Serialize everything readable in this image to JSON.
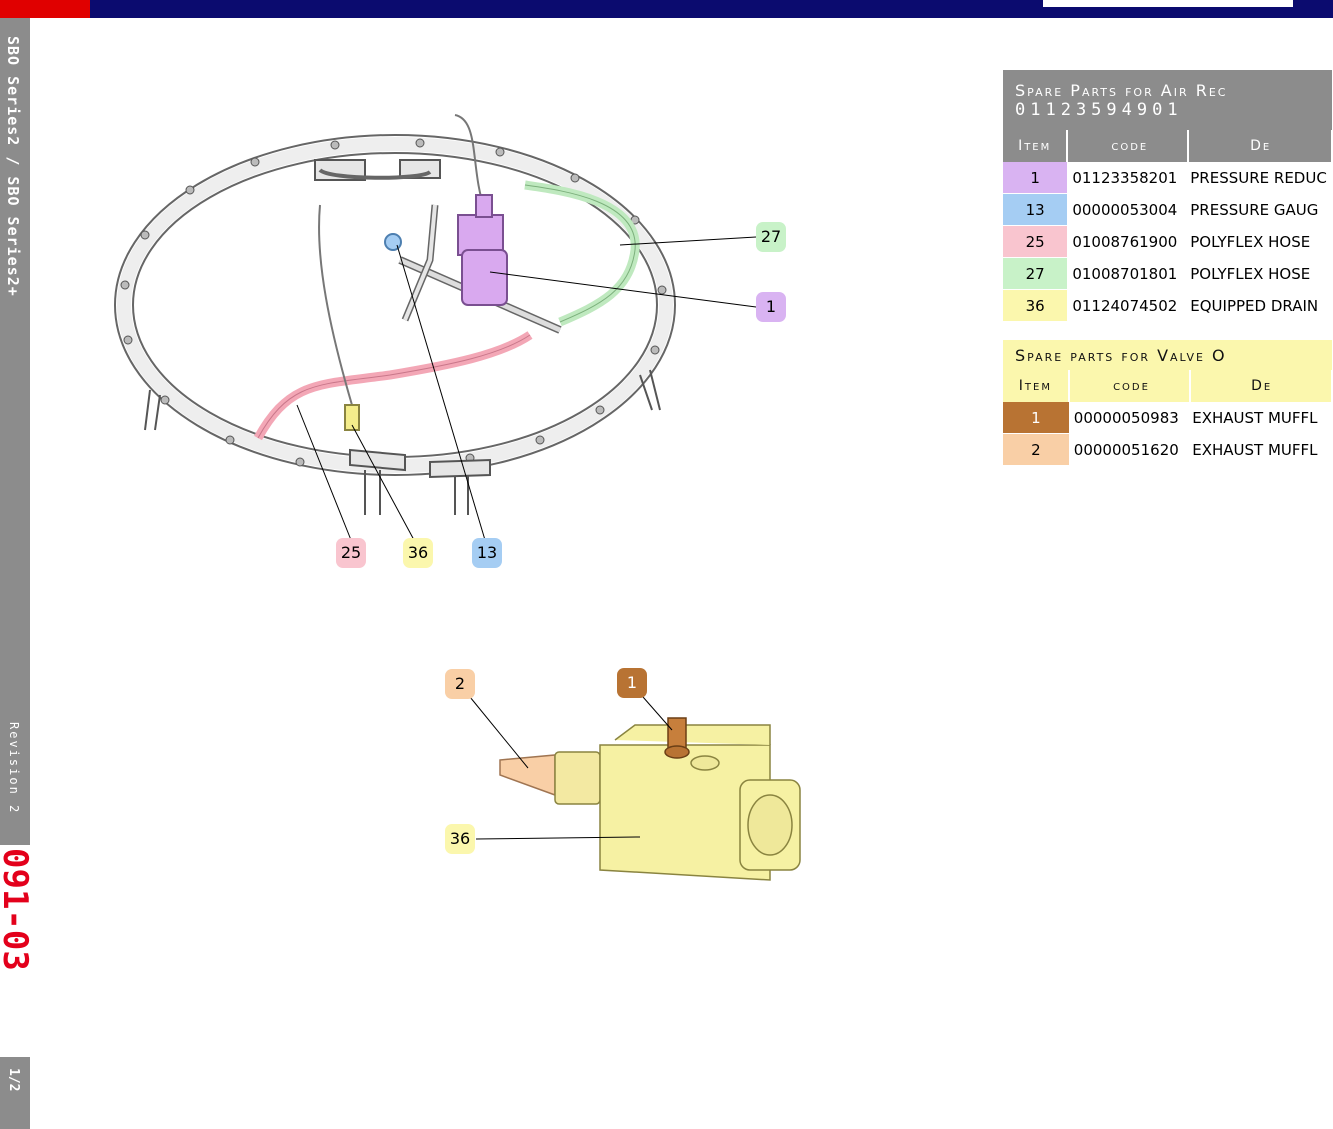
{
  "sidebar": {
    "series_text": "SBO Series2 / SBO Series2+",
    "revision": "Revision 2",
    "code": "091-03",
    "page": "1/2"
  },
  "table1": {
    "title_line1": "Spare Parts for Air Rec",
    "title_line2": "01123594901",
    "headers": [
      "Item",
      "code",
      "De"
    ],
    "rows": [
      {
        "item": "1",
        "code": "01123358201",
        "desc": "PRESSURE REDUC",
        "color": "#d9b3f2"
      },
      {
        "item": "13",
        "code": "00000053004",
        "desc": "PRESSURE GAUG",
        "color": "#a5cdf3"
      },
      {
        "item": "25",
        "code": "01008761900",
        "desc": "POLYFLEX HOSE",
        "color": "#f9c5cf"
      },
      {
        "item": "27",
        "code": "01008701801",
        "desc": "POLYFLEX HOSE",
        "color": "#c8f2c8"
      },
      {
        "item": "36",
        "code": "01124074502",
        "desc": "EQUIPPED DRAIN",
        "color": "#fbf7ad"
      }
    ]
  },
  "table2": {
    "title": "Spare parts for Valve O",
    "headers": [
      "Item",
      "code",
      "De"
    ],
    "rows": [
      {
        "item": "1",
        "code": "00000050983",
        "desc": "EXHAUST MUFFL",
        "color": "#b87333",
        "text_color": "#ffffff"
      },
      {
        "item": "2",
        "code": "00000051620",
        "desc": "EXHAUST MUFFL",
        "color": "#f9cfa6",
        "text_color": "#000000"
      }
    ]
  },
  "diagram1_callouts": [
    {
      "label": "27",
      "color": "#c8f2c8"
    },
    {
      "label": "1",
      "color": "#d9b3f2"
    },
    {
      "label": "25",
      "color": "#f9c5cf"
    },
    {
      "label": "36",
      "color": "#fbf7ad"
    },
    {
      "label": "13",
      "color": "#a5cdf3"
    }
  ],
  "diagram2_callouts": [
    {
      "label": "2",
      "color": "#f9cfa6"
    },
    {
      "label": "1",
      "color": "#b87333"
    },
    {
      "label": "36",
      "color": "#fbf7ad"
    }
  ]
}
